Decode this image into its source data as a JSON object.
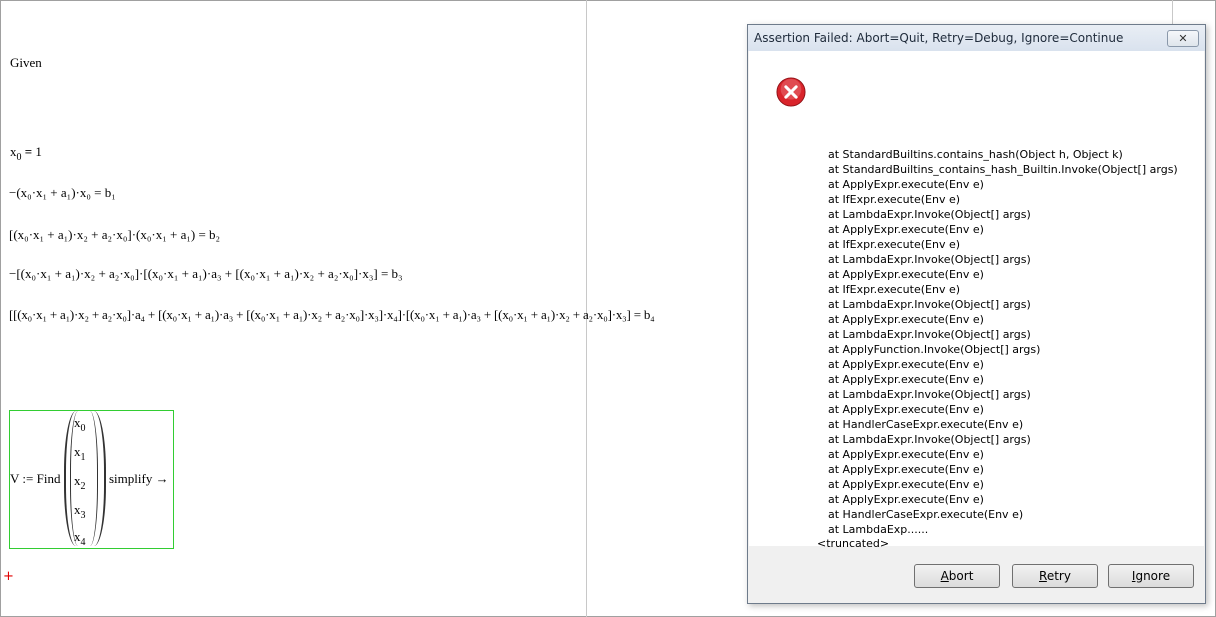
{
  "worksheet": {
    "given": "Given",
    "eq0": {
      "lhs": "x",
      "lhs_sub": "0",
      "op": "=",
      "rhs": "1"
    },
    "eq1_text": "−(x₀·x₁ + a₁)·x₀ = b₁",
    "eq2_text": "[(x₀·x₁ + a₁)·x₂ + a₂·x₀]·(x₀·x₁ + a₁) = b₂",
    "eq3_text": "−[(x₀·x₁ + a₁)·x₂ + a₂·x₀]·[(x₀·x₁ + a₁)·a₃ + [(x₀·x₁ + a₁)·x₂ + a₂·x₀]·x₃] = b₃",
    "eq4_text": "[[(x₀·x₁ + a₁)·x₂ + a₂·x₀]·a₄ + [(x₀·x₁ + a₁)·a₃ + [(x₀·x₁ + a₁)·x₂ + a₂·x₀]·x₃]·x₄]·[(x₀·x₁ + a₁)·a₃ + [(x₀·x₁ + a₁)·x₂ + a₂·x₀]·x₃] = b₄",
    "find": {
      "label": "V := Find",
      "vector": [
        {
          "var": "x",
          "sub": "0"
        },
        {
          "var": "x",
          "sub": "1"
        },
        {
          "var": "x",
          "sub": "2"
        },
        {
          "var": "x",
          "sub": "3"
        },
        {
          "var": "x",
          "sub": "4"
        }
      ],
      "operator": "simplify →"
    },
    "cursor": "+"
  },
  "dialog": {
    "title": "Assertion Failed: Abort=Quit, Retry=Debug, Ignore=Continue",
    "close_label": "✕",
    "icon": "error-icon",
    "trace": [
      "at StandardBuiltins.contains_hash(Object h, Object k)",
      "at StandardBuiltins_contains_hash_Builtin.Invoke(Object[] args)",
      "at ApplyExpr.execute(Env e)",
      "at IfExpr.execute(Env e)",
      "at LambdaExpr.Invoke(Object[] args)",
      "at ApplyExpr.execute(Env e)",
      "at IfExpr.execute(Env e)",
      "at LambdaExpr.Invoke(Object[] args)",
      "at ApplyExpr.execute(Env e)",
      "at IfExpr.execute(Env e)",
      "at LambdaExpr.Invoke(Object[] args)",
      "at ApplyExpr.execute(Env e)",
      "at LambdaExpr.Invoke(Object[] args)",
      "at ApplyFunction.Invoke(Object[] args)",
      "at ApplyExpr.execute(Env e)",
      "at ApplyExpr.execute(Env e)",
      "at LambdaExpr.Invoke(Object[] args)",
      "at ApplyExpr.execute(Env e)",
      "at HandlerCaseExpr.execute(Env e)",
      "at LambdaExpr.Invoke(Object[] args)",
      "at ApplyExpr.execute(Env e)",
      "at ApplyExpr.execute(Env e)",
      "at ApplyExpr.execute(Env e)",
      "at ApplyExpr.execute(Env e)",
      "at HandlerCaseExpr.execute(Env e)",
      "at LambdaExp......"
    ],
    "truncated": "<truncated>",
    "buttons": {
      "abort_mnemonic": "A",
      "abort_rest": "bort",
      "retry_mnemonic": "R",
      "retry_rest": "etry",
      "ignore_mnemonic": "I",
      "ignore_rest": "gnore"
    },
    "colors": {
      "error_red": "#d9242b",
      "accent_green": "#32cd32"
    }
  }
}
